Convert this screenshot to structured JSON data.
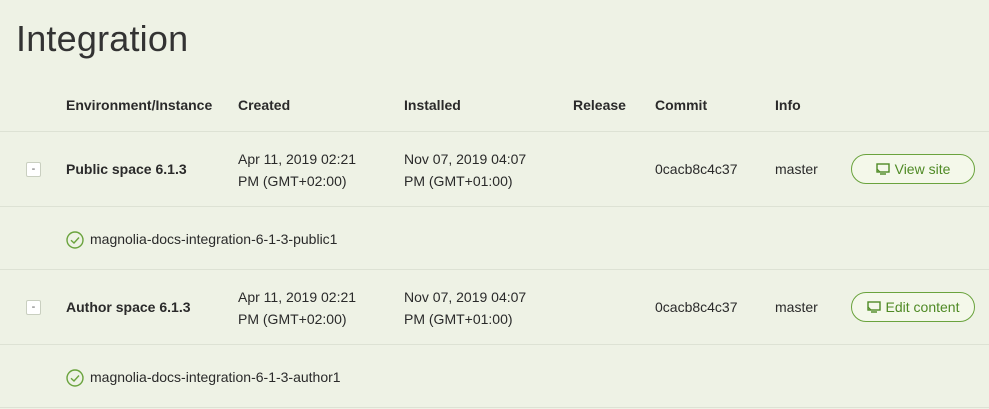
{
  "page": {
    "title": "Integration"
  },
  "table": {
    "headers": {
      "environment": "Environment/Instance",
      "created": "Created",
      "installed": "Installed",
      "release": "Release",
      "commit": "Commit",
      "info": "Info"
    },
    "environments": [
      {
        "toggle": "-",
        "name": "Public space 6.1.3",
        "created_line1": "Apr 11, 2019 02:21",
        "created_line2": "PM (GMT+02:00)",
        "installed_line1": "Nov 07, 2019 04:07",
        "installed_line2": "PM (GMT+01:00)",
        "release": "",
        "commit": "0cacb8c4c37",
        "info": "master",
        "action_label": "View site",
        "action_icon": "monitor-icon",
        "instance": {
          "name": "magnolia-docs-integration-6-1-3-public1",
          "status_icon": "check-circle-icon"
        }
      },
      {
        "toggle": "-",
        "name": "Author space 6.1.3",
        "created_line1": "Apr 11, 2019 02:21",
        "created_line2": "PM (GMT+02:00)",
        "installed_line1": "Nov 07, 2019 04:07",
        "installed_line2": "PM (GMT+01:00)",
        "release": "",
        "commit": "0cacb8c4c37",
        "info": "master",
        "action_label": "Edit content",
        "action_icon": "monitor-icon",
        "instance": {
          "name": "magnolia-docs-integration-6-1-3-author1",
          "status_icon": "check-circle-icon"
        }
      }
    ]
  },
  "colors": {
    "accent": "#6aa33d",
    "background": "#eef2e5"
  }
}
